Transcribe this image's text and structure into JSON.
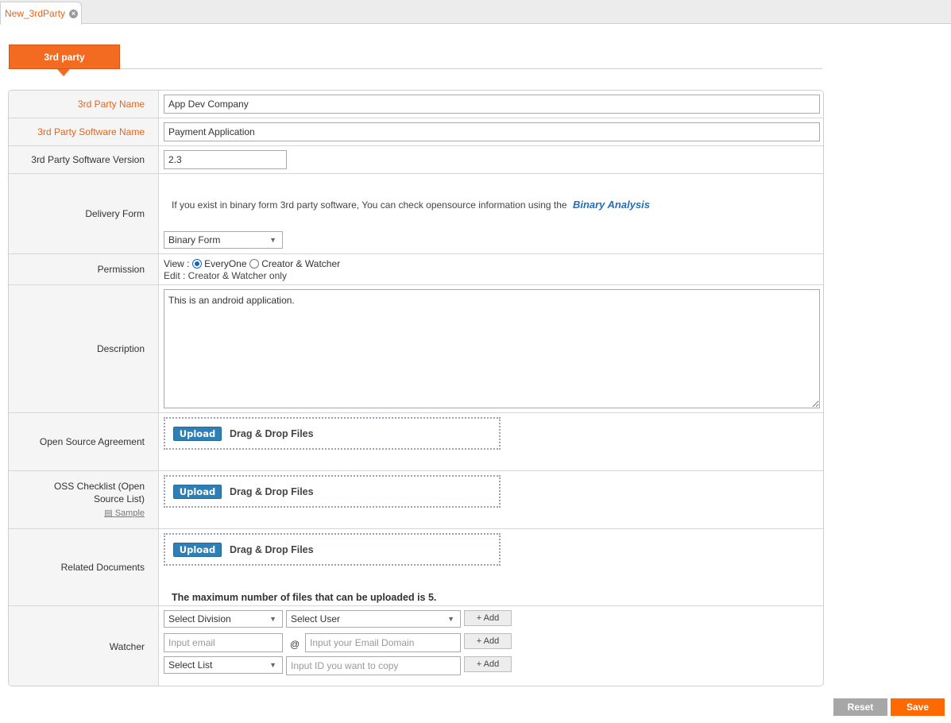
{
  "tab": {
    "label": "New_3rdParty",
    "close_icon": "×"
  },
  "section": {
    "title": "3rd party"
  },
  "form": {
    "name": {
      "label": "3rd Party Name",
      "value": "App Dev Company"
    },
    "software_name": {
      "label": "3rd Party Software Name",
      "value": "Payment Application"
    },
    "software_version": {
      "label": "3rd Party Software Version",
      "value": "2.3"
    },
    "delivery": {
      "label": "Delivery Form",
      "info": "If you exist in binary form 3rd party software, You can check opensource information using the",
      "link": "Binary Analysis",
      "selected": "Binary Form"
    },
    "permission": {
      "label": "Permission",
      "view_prefix": "View :",
      "option_everyone": "EveryOne",
      "option_creator": "Creator & Watcher",
      "edit_line": "Edit : Creator & Watcher only"
    },
    "description": {
      "label": "Description",
      "value": "This is an android application."
    },
    "agreement": {
      "label": "Open Source Agreement"
    },
    "checklist": {
      "label": "OSS Checklist (Open Source List)",
      "sample": "Sample"
    },
    "related": {
      "label": "Related Documents",
      "max_note": "The maximum number of files that can be uploaded is 5."
    },
    "upload_label": "Upload",
    "drag_drop_label": "Drag & Drop Files",
    "watcher": {
      "label": "Watcher",
      "select_division": "Select Division",
      "select_user": "Select User",
      "email_placeholder": "Input email",
      "at": "@",
      "domain_placeholder": "Input your Email Domain",
      "select_list": "Select List",
      "copy_placeholder": "Input ID you want to copy",
      "add_label": "+ Add"
    }
  },
  "buttons": {
    "reset": "Reset",
    "save": "Save"
  },
  "colors": {
    "accent": "#f26b21",
    "save": "#ff6a00",
    "upload": "#2f7fb7",
    "link": "#1f6fbf"
  }
}
